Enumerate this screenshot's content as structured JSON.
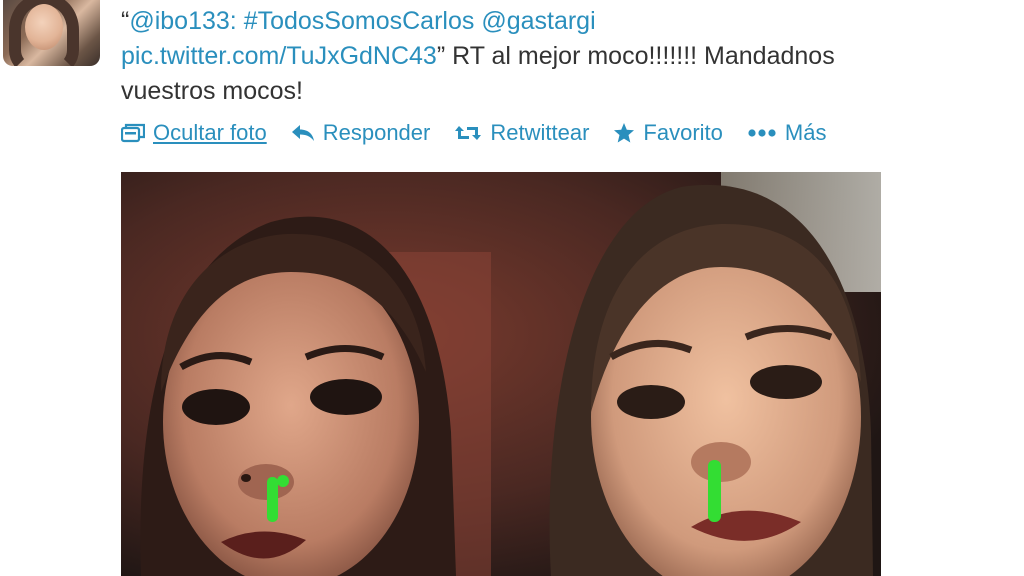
{
  "tweet": {
    "line1_prefix": "“",
    "mention_user": "@ibo133:",
    "hashtag": "#TodosSomosCarlos",
    "mention_second": "@gastargi",
    "link": "pic.twitter.com/TuJxGdNC43",
    "link_suffix": "” RT al mejor moco!!!!!!! Mandadnos",
    "line3": "vuestros mocos!"
  },
  "actions": {
    "hide_photo": "Ocultar foto",
    "reply": "Responder",
    "retweet": "Retwittear",
    "favorite": "Favorito",
    "more": "Más"
  },
  "icons": {
    "hide_photo": "photo-icon",
    "reply": "reply-arrow-icon",
    "retweet": "retweet-icon",
    "favorite": "star-icon",
    "more": "ellipsis-icon"
  },
  "colors": {
    "link": "#2a8fbd",
    "text": "#333333",
    "nose_mark": "#33dd33"
  }
}
